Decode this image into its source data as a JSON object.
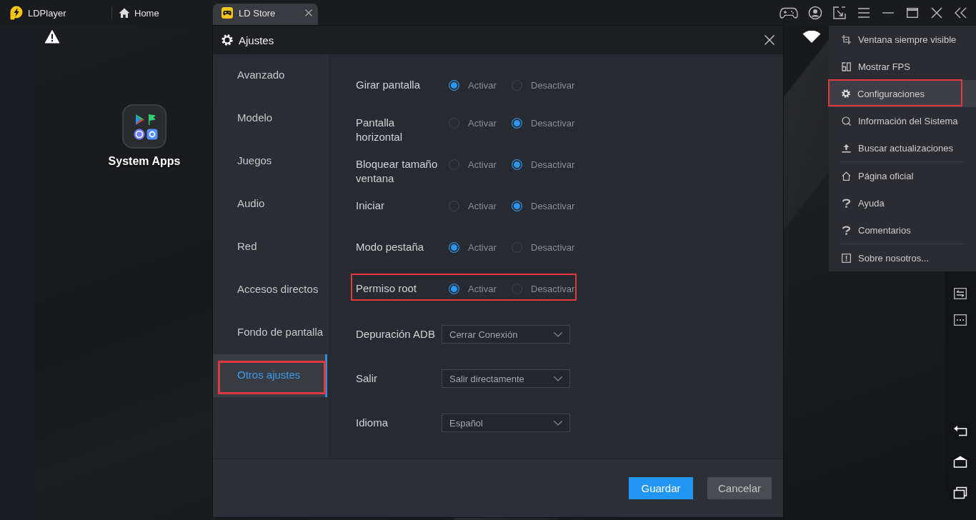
{
  "title_bar": {
    "app_name": "LDPlayer",
    "tabs": [
      {
        "kind": "home",
        "label": "Home",
        "selected": false
      },
      {
        "kind": "app",
        "label": "LD Store",
        "selected": true
      }
    ]
  },
  "desktop": {
    "apps": [
      {
        "label": "System Apps"
      }
    ]
  },
  "settings_dialog": {
    "title": "Ajustes",
    "nav": [
      {
        "label": "Avanzado",
        "selected": false,
        "highlighted": false
      },
      {
        "label": "Modelo",
        "selected": false,
        "highlighted": false
      },
      {
        "label": "Juegos",
        "selected": false,
        "highlighted": false
      },
      {
        "label": "Audio",
        "selected": false,
        "highlighted": false
      },
      {
        "label": "Red",
        "selected": false,
        "highlighted": false
      },
      {
        "label": "Accesos directos",
        "selected": false,
        "highlighted": false
      },
      {
        "label": "Fondo de pantalla",
        "selected": false,
        "highlighted": false
      },
      {
        "label": "Otros ajustes",
        "selected": true,
        "highlighted": true
      }
    ],
    "options": [
      {
        "kind": "radio",
        "label": "Girar pantalla",
        "highlighted": false,
        "choices": [
          {
            "label": "Activar",
            "selected": true
          },
          {
            "label": "Desactivar",
            "selected": false
          }
        ]
      },
      {
        "kind": "radio",
        "label": "Pantalla horizontal",
        "highlighted": false,
        "choices": [
          {
            "label": "Activar",
            "selected": false
          },
          {
            "label": "Desactivar",
            "selected": true
          }
        ]
      },
      {
        "kind": "radio",
        "label": "Bloquear tamaño ventana",
        "highlighted": false,
        "choices": [
          {
            "label": "Activar",
            "selected": false
          },
          {
            "label": "Desactivar",
            "selected": true
          }
        ]
      },
      {
        "kind": "radio",
        "label": "Iniciar",
        "highlighted": false,
        "choices": [
          {
            "label": "Activar",
            "selected": false
          },
          {
            "label": "Desactivar",
            "selected": true
          }
        ]
      },
      {
        "kind": "radio",
        "label": "Modo pestaña",
        "highlighted": false,
        "choices": [
          {
            "label": "Activar",
            "selected": true
          },
          {
            "label": "Desactivar",
            "selected": false
          }
        ]
      },
      {
        "kind": "radio",
        "label": "Permiso root",
        "highlighted": true,
        "choices": [
          {
            "label": "Activar",
            "selected": true
          },
          {
            "label": "Desactivar",
            "selected": false
          }
        ]
      },
      {
        "kind": "dropdown",
        "label": "Depuración ADB",
        "highlighted": false,
        "value": "Cerrar Conexión"
      },
      {
        "kind": "dropdown",
        "label": "Salir",
        "highlighted": false,
        "value": "Salir directamente"
      },
      {
        "kind": "dropdown",
        "label": "Idioma",
        "highlighted": false,
        "value": "Español"
      }
    ],
    "buttons": [
      {
        "kind": "primary",
        "label": "Guardar"
      },
      {
        "kind": "secondary",
        "label": "Cancelar"
      }
    ]
  },
  "menu": {
    "groups": [
      {
        "items": [
          {
            "label": "Ventana siempre visible",
            "selected": false,
            "highlighted": false
          },
          {
            "label": "Mostrar FPS",
            "selected": false,
            "highlighted": false
          },
          {
            "label": "Configuraciones",
            "selected": true,
            "highlighted": true
          },
          {
            "label": "Información del Sistema",
            "selected": false,
            "highlighted": false
          },
          {
            "label": "Buscar actualizaciones",
            "selected": false,
            "highlighted": false
          }
        ]
      },
      {
        "items": [
          {
            "label": "Página oficial",
            "selected": false,
            "highlighted": false
          },
          {
            "label": "Ayuda",
            "selected": false,
            "highlighted": false
          },
          {
            "label": "Comentarios",
            "selected": false,
            "highlighted": false
          }
        ]
      },
      {
        "items": [
          {
            "label": "Sobre nosotros...",
            "selected": false,
            "highlighted": false
          }
        ]
      }
    ]
  }
}
